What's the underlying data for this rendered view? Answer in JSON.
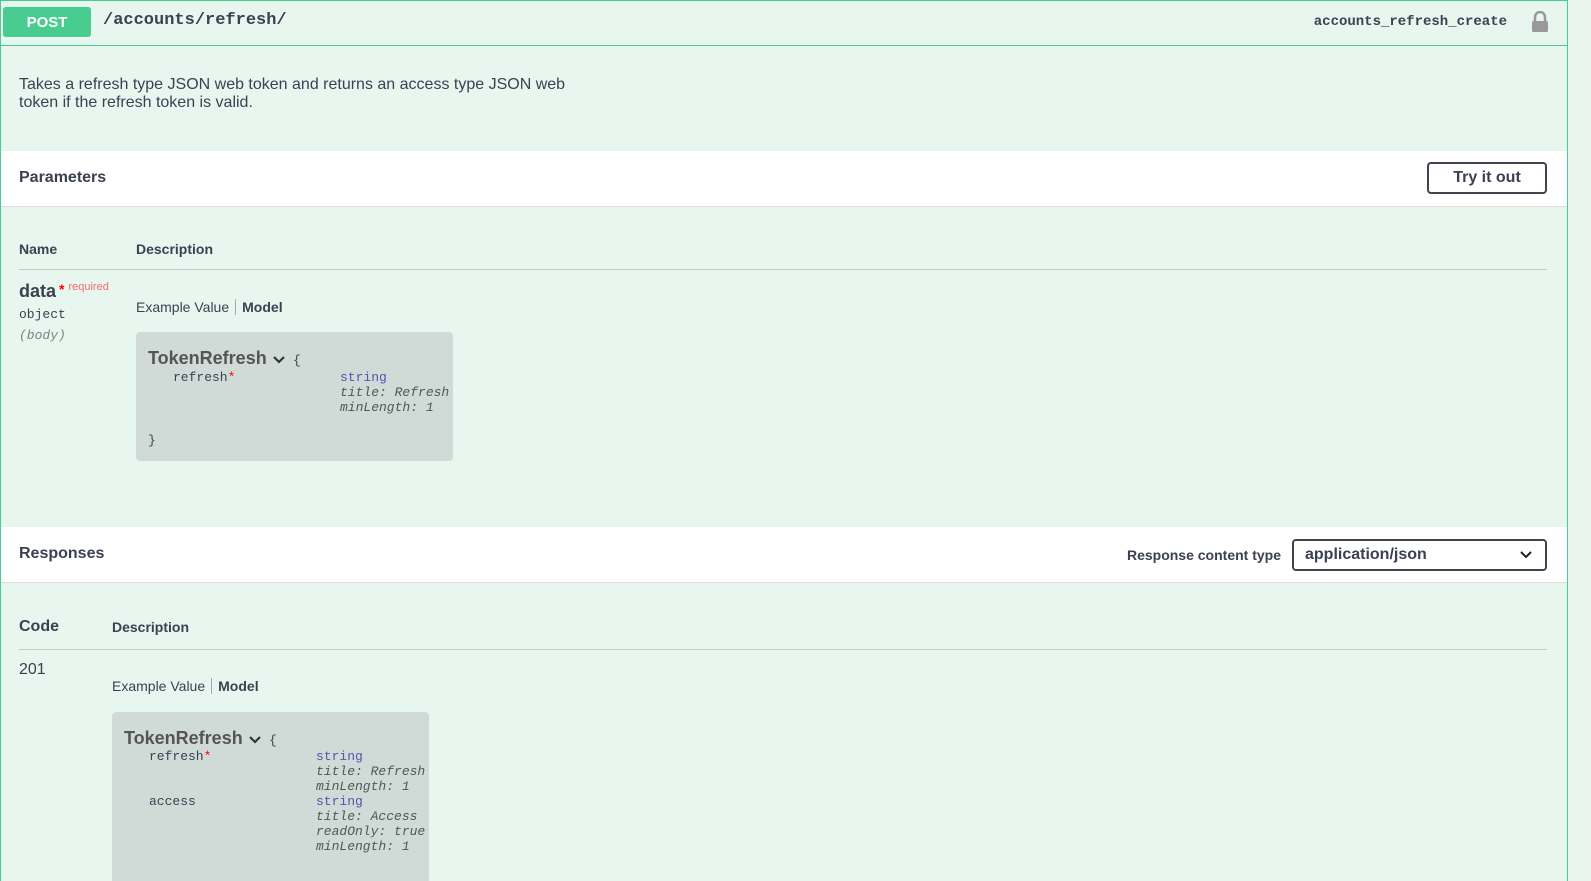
{
  "endpoint": {
    "method": "POST",
    "path": "/accounts/refresh/",
    "operation_id": "accounts_refresh_create",
    "description": "Takes a refresh type JSON web token and returns an access type JSON web token if the refresh token is valid."
  },
  "parameters": {
    "title": "Parameters",
    "try_it_out_label": "Try it out",
    "col_name": "Name",
    "col_description": "Description",
    "param": {
      "name": "data",
      "required_star": "*",
      "required_text": "required",
      "type": "object",
      "in": "(body)"
    },
    "tab_example": "Example Value",
    "tab_model": "Model",
    "model": {
      "name": "TokenRefresh",
      "open_brace": "{",
      "close_brace": "}",
      "props": [
        {
          "name": "refresh",
          "required": "*",
          "type": "string",
          "meta1": "title: Refresh",
          "meta2": "minLength: 1"
        }
      ]
    }
  },
  "responses": {
    "title": "Responses",
    "content_type_label": "Response content type",
    "content_type_value": "application/json",
    "col_code": "Code",
    "col_description": "Description",
    "code": "201",
    "tab_example": "Example Value",
    "tab_model": "Model",
    "model": {
      "name": "TokenRefresh",
      "open_brace": "{",
      "props": [
        {
          "name": "refresh",
          "required": "*",
          "type": "string",
          "meta1": "title: Refresh",
          "meta2": "minLength: 1"
        },
        {
          "name": "access",
          "type": "string",
          "meta1": "title: Access",
          "meta2": "readOnly: true",
          "meta3": "minLength: 1"
        }
      ]
    }
  },
  "icons": {
    "lock": "lock-icon",
    "chevron": "chevron-down-icon"
  },
  "colors": {
    "post_accent": "#49cc90",
    "block_bg": "#e8f6f0",
    "model_bg": "#d0dbd8"
  }
}
